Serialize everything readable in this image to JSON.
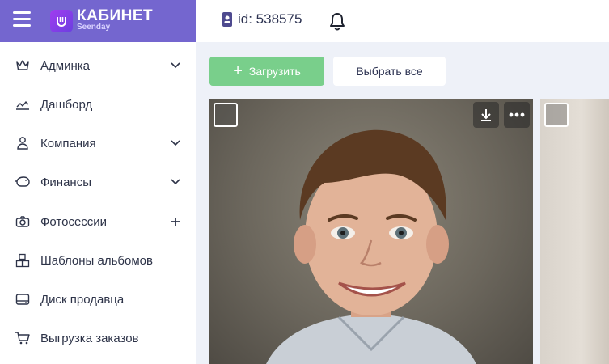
{
  "brand": {
    "title": "КАБИНЕТ",
    "subtitle": "Seenday",
    "colors": {
      "header": "#7466cf",
      "logo": "#8b3ff0"
    }
  },
  "topbar": {
    "id_text": "id: 538575"
  },
  "sidebar": {
    "items": [
      {
        "label": "Админка",
        "icon": "crown-icon",
        "right": "chevron"
      },
      {
        "label": "Дашборд",
        "icon": "chart-line-icon",
        "right": "none"
      },
      {
        "label": "Компания",
        "icon": "users-icon",
        "right": "chevron"
      },
      {
        "label": "Финансы",
        "icon": "piggy-bank-icon",
        "right": "chevron"
      },
      {
        "label": "Фотосессии",
        "icon": "camera-icon",
        "right": "plus"
      },
      {
        "label": "Шаблоны альбомов",
        "icon": "boxes-icon",
        "right": "none"
      },
      {
        "label": "Диск продавца",
        "icon": "disk-icon",
        "right": "none"
      },
      {
        "label": "Выгрузка заказов",
        "icon": "cart-icon",
        "right": "none"
      }
    ]
  },
  "toolbar": {
    "upload_label": "Загрузить",
    "select_all_label": "Выбрать все",
    "colors": {
      "upload": "#79cf8b"
    }
  }
}
